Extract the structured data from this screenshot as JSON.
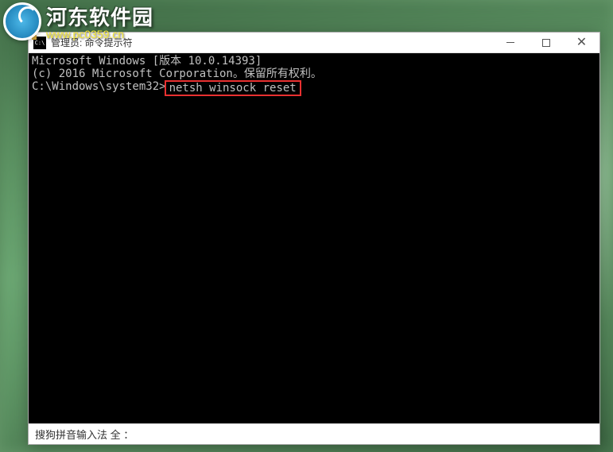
{
  "watermark": {
    "title": "河东软件园",
    "url": "www.pc0359.cn"
  },
  "window": {
    "title": "管理员: 命令提示符"
  },
  "console": {
    "line1": "Microsoft Windows [版本 10.0.14393]",
    "line2": "(c) 2016 Microsoft Corporation。保留所有权利。",
    "blank": "",
    "prompt": "C:\\Windows\\system32>",
    "command": "netsh winsock reset"
  },
  "statusbar": {
    "ime_text": "搜狗拼音输入法 全 ："
  }
}
